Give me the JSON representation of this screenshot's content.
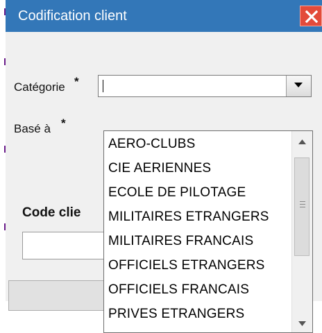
{
  "window": {
    "title": "Codification client",
    "close_icon": "close-icon",
    "colors": {
      "titlebar": "#3377b8",
      "close": "#e34b3a"
    }
  },
  "form": {
    "categorie_label": "Catégorie",
    "base_label": "Basé à",
    "required_mark": "*",
    "categorie_value": "",
    "code_client_label": "Code clie",
    "code_client_value": ""
  },
  "dropdown": {
    "options": [
      "AERO-CLUBS",
      "CIE AERIENNES",
      "ECOLE DE PILOTAGE",
      "MILITAIRES ETRANGERS",
      "MILITAIRES FRANCAIS",
      "OFFICIELS ETRANGERS",
      "OFFICIELS FRANCAIS",
      "PRIVES ETRANGERS"
    ]
  }
}
